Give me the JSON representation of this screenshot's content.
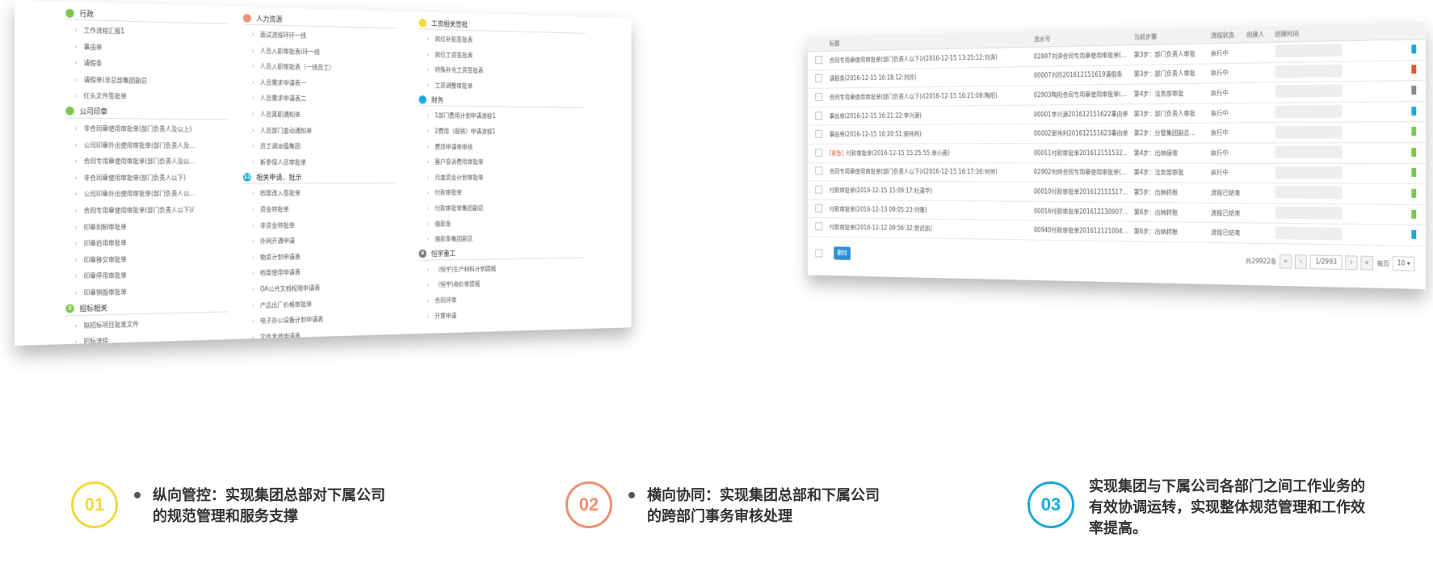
{
  "colors": {
    "yellow": "#f5d83a",
    "orange": "#ee9070",
    "blue": "#1aa8dc",
    "green": "#7cc84e",
    "delete_button": "#2c8ed6"
  },
  "left_panel": {
    "columns": [
      {
        "groups": [
          {
            "badge": "",
            "title": "行政",
            "color": "#7cc84e",
            "items": [
              "工作流程汇报1",
              "事由单",
              "请假条",
              "请假单(非总部集团副总",
              "红头文件签批单"
            ]
          },
          {
            "badge": "",
            "title": "公司印章",
            "color": "#7cc84e",
            "items": [
              "非合同章使用审批单(部门负责人及以上)",
              "公司印章外出使用审批单(部门负责人及...",
              "合同专用章使用审批单(部门负责人及以...",
              "非合同章使用审批单(部门负责人以下)",
              "公司印章外出使用审批单(部门负责人以...",
              "合同专用章使用审批单(部门负责人以下)/",
              "印章刻制审批单",
              "印章启用审批单",
              "印章移交审批单",
              "印章停用审批单",
              "印章销毁审批单"
            ]
          },
          {
            "badge": "2",
            "title": "招标相关",
            "color": "#7cc84e",
            "items": [
              "拟招标项目批准文件",
              "招标流程"
            ]
          }
        ]
      },
      {
        "groups": [
          {
            "badge": "",
            "title": "人力资源",
            "color": "#ee9070",
            "items": [
              "面试流程环环一线",
              "人员入职审批表(环一线",
              "人员入职审批表（一线员工）",
              "人员需求申请表一",
              "人员需求申请表二",
              "人员离职通知单",
              "人员部门变动通知单",
              "员工调派值集团",
              "新参保人员审批单"
            ]
          },
          {
            "badge": "12",
            "title": "相关申请、批示",
            "color": "#1aa8dc",
            "items": [
              "档案改入签批单",
              "资金特批单",
              "非资金特批单",
              "外网开通申请",
              "物资计划申请表",
              "档案使用申请表",
              "OA公共文档权限申请表",
              "产品出厂价格审批单",
              "电子办公设备计划申请表",
              "文件发放申请表"
            ]
          }
        ]
      },
      {
        "groups": [
          {
            "badge": "",
            "title": "工资相关签批",
            "color": "#f5d83a",
            "items": [
              "岗位补贴签批表",
              "岗位工资签批表",
              "特殊补充工资签批表",
              "工资调整审批单"
            ]
          },
          {
            "badge": "",
            "title": "财务",
            "color": "#1aa8dc",
            "items": [
              "1部门费用计划申请流程1",
              "2费用（报销）申请流程1",
              "费用申请单审核",
              "客户投诉费用审批单",
              "月度资金计划审批单",
              "付款审批单",
              "付款审批单集团副总",
              "借款条",
              "借款条集团副总"
            ]
          },
          {
            "badge": "4",
            "title": "恒宇重工",
            "color": "#777777",
            "items": [
              "（恒宇)生产材料计划提报",
              "（恒宇)询价单提报",
              "合同评审",
              "开票申请"
            ]
          }
        ]
      }
    ]
  },
  "right_panel": {
    "columns": [
      "标题",
      "流水号",
      "当前步骤",
      "流程状态",
      "创建人",
      "创建时间"
    ],
    "rows": [
      {
        "title": "合同专用章使用审批单(部门负责人以下)/(2016-12-15 13:25:12:刘湃)",
        "serial": "02897刘湃合同专用章使用审批单(...",
        "step": "第3步：部门负责人审批",
        "status": "执行中",
        "color": "#1aa8dc"
      },
      {
        "title": "请假条(2016-12-15 16:18:12:刘玲)",
        "serial": "00007刘玲201612151619请假条",
        "step": "第3步：部门负责人审批",
        "status": "执行中",
        "color": "#e2552b"
      },
      {
        "title": "合同专用章使用审批单(部门负责人以下)/(2016-12-15 16:21:08:陶阳)",
        "serial": "02903陶阳合同专用章使用审批单(...",
        "step": "第4步：法务部审批",
        "status": "执行中",
        "color": "#888888"
      },
      {
        "title": "事由单(2016-12-15 16:21:22:李兴源)",
        "serial": "00001李兴源201612151622事由单",
        "step": "第3步：部门负责人审批",
        "status": "执行中",
        "color": "#1aa8dc"
      },
      {
        "title": "事由单(2016-12-15 16:20:51:郭伟利)",
        "serial": "00002郭伟利201612151623事由单",
        "step": "第2步：分管集团副总...",
        "status": "执行中",
        "color": "#7cc84e"
      },
      {
        "title": "付款审批单(2016-12-15 15:25:55:单小燕)",
        "serial": "00011付款审批单201612151532...",
        "step": "第4步：出纳接收",
        "status": "执行中",
        "color": "#7cc84e",
        "urgent": "[紧急]"
      },
      {
        "title": "合同专用章使用审批单(部门负责人以下)/(2016-12-15 16:17:36:何帅)",
        "serial": "02902何帅合同专用章使用审批单(...",
        "step": "第4步：法务部审批",
        "status": "执行中",
        "color": "#7cc84e"
      },
      {
        "title": "付款审批单(2016-12-15 15:09:17:杜清华)",
        "serial": "00010付款审批单201612151517...",
        "step": "第5步：出纳转账",
        "status": "流程已结束",
        "color": "#7cc84e"
      },
      {
        "title": "付款审批单(2016-12-13 09:05:23:刘雅)",
        "serial": "00016付款审批单201612130907...",
        "step": "第6步：出纳转账",
        "status": "流程已结束",
        "color": "#7cc84e"
      },
      {
        "title": "付款审批单(2016-12-12 09:56:32:贺迟凯)",
        "serial": "00940付款审批单201612121004...",
        "step": "第6步：出纳转账",
        "status": "流程已结束",
        "color": "#1aa8dc"
      }
    ],
    "delete_label": "删除",
    "total": "共29922条",
    "page": "1/2993",
    "per_page_label": "每页",
    "per_page": "10"
  },
  "features": [
    {
      "num": "01",
      "color": "#f5d83a",
      "text_line1": "纵向管控：实现集团总部对下属公司",
      "text_line2": "的规范管理和服务支撑",
      "text_line3": "",
      "bullet": true
    },
    {
      "num": "02",
      "color": "#ee9070",
      "text_line1": "横向协同：实现集团总部和下属公司",
      "text_line2": "的跨部门事务审核处理",
      "text_line3": "",
      "bullet": true
    },
    {
      "num": "03",
      "color": "#1aa8dc",
      "text_line1": "实现集团与下属公司各部门之间工作业务的",
      "text_line2": "有效协调运转，实现整体规范管理和工作效",
      "text_line3": "率提高。",
      "bullet": false
    }
  ]
}
